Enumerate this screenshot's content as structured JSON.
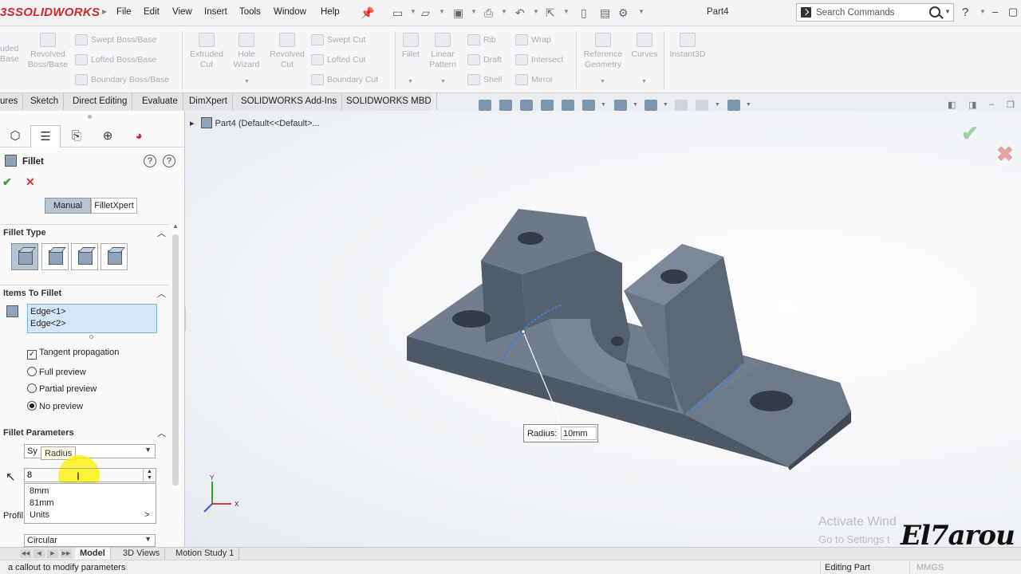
{
  "app": {
    "logo_mark": "3S",
    "logo_text": "SOLIDWORKS"
  },
  "menu": [
    "File",
    "Edit",
    "View",
    "Insert",
    "Tools",
    "Window",
    "Help"
  ],
  "document_title": "Part4",
  "search": {
    "placeholder": "Search Commands"
  },
  "command_manager": {
    "left_cut": [
      "uded",
      "Base"
    ],
    "extruded_boss": "Revolved Boss/Base",
    "features_rows": [
      "Swept Boss/Base",
      "Lofted Boss/Base",
      "Boundary Boss/Base"
    ],
    "cut_tools": [
      "Extruded Cut",
      "Hole Wizard",
      "Revolved Cut"
    ],
    "cut_rows": [
      "Swept Cut",
      "Lofted Cut",
      "Boundary Cut"
    ],
    "pattern_tools": [
      "Fillet",
      "Linear Pattern"
    ],
    "pattern_rows_a": [
      "Rib",
      "Draft",
      "Shell"
    ],
    "pattern_rows_b": [
      "Wrap",
      "Intersect",
      "Mirror"
    ],
    "ref_geometry": "Reference Geometry",
    "curves": "Curves",
    "instant3d": "Instant3D"
  },
  "tabs": [
    "ures",
    "Sketch",
    "Direct Editing",
    "Evaluate",
    "DimXpert",
    "SOLIDWORKS Add-Ins",
    "SOLIDWORKS MBD"
  ],
  "property_manager": {
    "title": "Fillet",
    "help": "?",
    "ok": "✔",
    "cancel": "✕",
    "mode_manual": "Manual",
    "mode_expert": "FilletXpert",
    "sections": {
      "fillet_type": "Fillet Type",
      "items_to_fillet": "Items To Fillet",
      "fillet_parameters": "Fillet Parameters"
    },
    "edges": [
      "Edge<1>",
      "Edge<2>"
    ],
    "tangent_propagation": "Tangent propagation",
    "preview_options": [
      "Full preview",
      "Partial preview",
      "No preview"
    ],
    "preview_selected": "No preview",
    "symmetric_partial": "Sy",
    "tooltip": "Radius",
    "radius_value": "8",
    "suggestions": [
      "8mm",
      "81mm",
      "Units"
    ],
    "profile_label": "Profil",
    "profile_value": "Circular"
  },
  "viewport": {
    "breadcrumb": "Part4  (Default<<Default>...",
    "callout_label": "Radius:",
    "callout_value": "10mm"
  },
  "watermark": {
    "line1": "Activate Wind",
    "line2": "Go to Settings t",
    "signature": "El7arou"
  },
  "bottom_tabs": [
    "Model",
    "3D Views",
    "Motion Study 1"
  ],
  "status": {
    "message": "a callout to modify parameters",
    "mode": "Editing Part",
    "units": "MMGS"
  },
  "colors": {
    "accent_red": "#d22630",
    "selection_blue": "#d4e6f7",
    "model_gray": "#5f6b7a",
    "highlight_yellow": "#fff000"
  }
}
